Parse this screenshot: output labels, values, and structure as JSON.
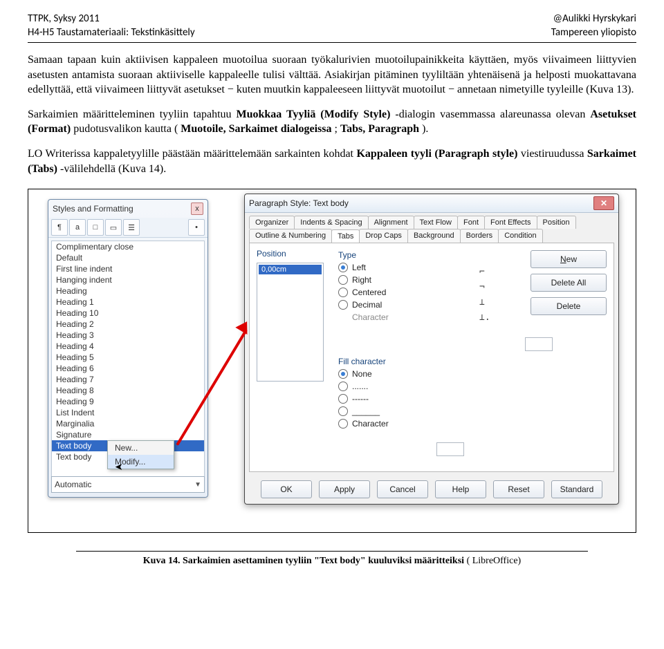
{
  "header": {
    "left1": "TTPK, Syksy 2011",
    "left2": "H4-H5 Taustamateriaali: Tekstinkäsittely",
    "right1": "@Aulikki Hyrskykari",
    "right2": "Tampereen yliopisto"
  },
  "para1": "Samaan tapaan kuin aktiivisen kappaleen muotoilua suoraan työkalurivien muotoilupainikkeita käyttäen, myös viivaimeen liittyvien asetusten antamista suoraan aktiiviselle kappaleelle tulisi välttää. Asiakirjan pitäminen tyyliltään yhtenäisenä ja helposti muokattavana edellyttää, että viivaimeen liittyvät asetukset − kuten muutkin kappaleeseen liittyvät muotoilut − annetaan nimetyille tyyleille (Kuva 13).",
  "para2_pre": "Sarkaimien määritteleminen tyyliin tapahtuu ",
  "para2_b1": "Muokkaa Tyyliä (Modify Style)",
  "para2_mid1": " -dialogin vasemmassa alareunassa olevan ",
  "para2_b2": "Asetukset (Format) ",
  "para2_mid2": "pudotusvalikon kautta (",
  "para2_b3": "Muotoile, Sarkaimet  dialogeissa",
  "para2_mid3": "; ",
  "para2_b4": "Tabs, Paragraph",
  "para2_end": ").",
  "para3_pre": "LO Writerissa kappaletyylille päästään määrittelemään sarkainten kohdat ",
  "para3_b1": "Kappaleen tyyli (Paragraph style)",
  "para3_mid1": " viestiruudussa ",
  "para3_b2": "Sarkaimet (Tabs)",
  "para3_end": " -välilehdellä (Kuva 14).",
  "sf": {
    "title": "Styles and Formatting",
    "close": "x",
    "toolbar": [
      "¶",
      "a",
      "□",
      "▭",
      "☰",
      "•"
    ],
    "items": [
      "Complimentary close",
      "Default",
      "First line indent",
      "Hanging indent",
      "Heading",
      "Heading 1",
      "Heading 10",
      "Heading 2",
      "Heading 3",
      "Heading 4",
      "Heading 5",
      "Heading 6",
      "Heading 7",
      "Heading 8",
      "Heading 9",
      "List Indent",
      "Marginalia",
      "Signature",
      "Text body",
      "Text body"
    ],
    "selectedIndex": 18,
    "ctxNew": "New...",
    "ctxModify": "Modify...",
    "combo": "Automatic"
  },
  "ps": {
    "title": "Paragraph Style: Text body",
    "tabsRow1": [
      "Organizer",
      "Indents & Spacing",
      "Alignment",
      "Text Flow",
      "Font",
      "Font Effects",
      "Position"
    ],
    "tabsRow2": [
      "Outline & Numbering",
      "Tabs",
      "Drop Caps",
      "Background",
      "Borders",
      "Condition"
    ],
    "activeTab": "Tabs",
    "posLabel": "Position",
    "posValue": "0,00cm",
    "typeLabel": "Type",
    "typeLeft": "Left",
    "typeRight": "Right",
    "typeCentered": "Centered",
    "typeDecimal": "Decimal",
    "typeCharacter": "Character",
    "fillLabel": "Fill character",
    "fillNone": "None",
    "fillDots": ".......",
    "fillDashes": "------",
    "fillUnders": "______",
    "fillChar": "Character",
    "tabstopGlyphs": [
      "⌐",
      "¬",
      "⊥",
      "⊥."
    ],
    "btnNew": "New",
    "btnDeleteAll": "Delete All",
    "btnDelete": "Delete",
    "btnOK": "OK",
    "btnApply": "Apply",
    "btnCancel": "Cancel",
    "btnHelp": "Help",
    "btnReset": "Reset",
    "btnStandard": "Standard"
  },
  "caption": {
    "label": "Kuva 14. Sarkaimien asettaminen tyyliin \"Text body\" kuuluviksi määritteiksi ",
    "note": "( LibreOffice)"
  }
}
